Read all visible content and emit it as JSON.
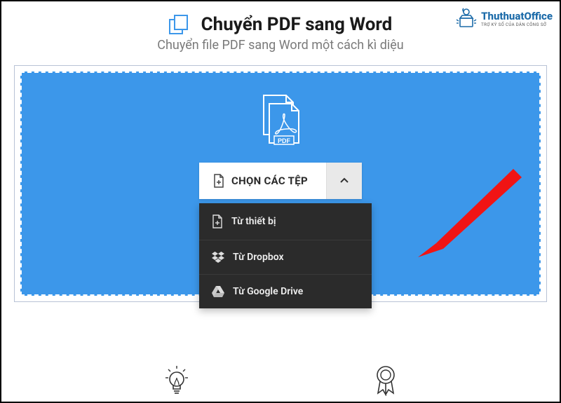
{
  "header": {
    "title": "Chuyển PDF sang Word",
    "subtitle": "Chuyển file PDF sang Word một cách kì diệu"
  },
  "upload": {
    "button_label": "CHỌN CÁC TỆP",
    "dropdown": [
      {
        "label": "Từ thiết bị"
      },
      {
        "label": "Từ Dropbox"
      },
      {
        "label": "Từ Google Drive"
      }
    ]
  },
  "watermark": {
    "brand": "ThuthuatOffice",
    "tagline": "TRỢ KÝ SỐ CỦA DÂN CÔNG SỞ"
  },
  "colors": {
    "primary_blue": "#3c97ea",
    "arrow_red": "#f01414",
    "menu_dark": "#2b2b2b"
  }
}
